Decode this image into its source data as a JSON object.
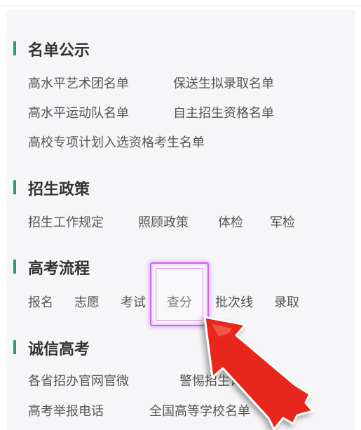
{
  "sections": [
    {
      "title": "名单公示",
      "links": [
        "高水平艺术团名单",
        "保送生拟录取名单",
        "高水平运动队名单",
        "自主招生资格名单",
        "高校专项计划入选资格考生名单"
      ]
    },
    {
      "title": "招生政策",
      "links": [
        "招生工作规定",
        "照顾政策",
        "体检",
        "军检"
      ]
    },
    {
      "title": "高考流程",
      "links": [
        "报名",
        "志愿",
        "考试",
        "查分",
        "批次线",
        "录取"
      ]
    },
    {
      "title": "诚信高考",
      "links": [
        "各省招办官网官微",
        "警惕招生诈",
        "高考举报电话",
        "全国高等学校名单"
      ]
    }
  ],
  "colors": {
    "accent": "#2a9d6c",
    "highlight": "#cc66ee",
    "arrow_fill": "#e8271b"
  },
  "highlighted_item": "查分"
}
